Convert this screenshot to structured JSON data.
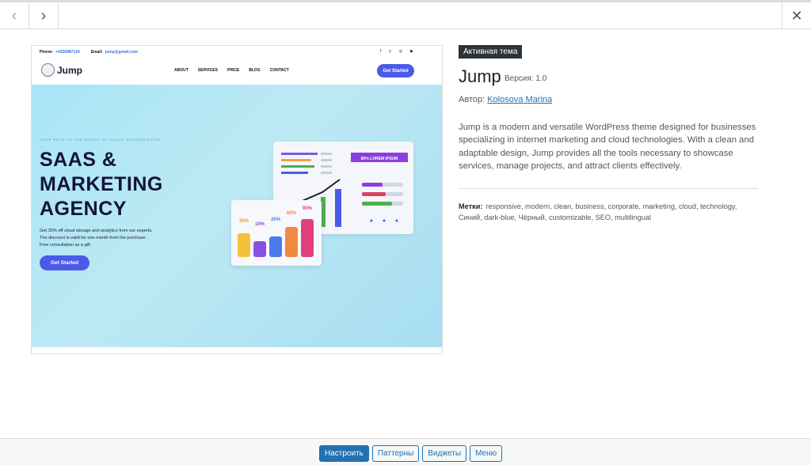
{
  "nav": {
    "prev_icon": "‹",
    "next_icon": "›",
    "close_icon": "✕"
  },
  "preview": {
    "phone_label": "Phone:",
    "phone_value": "+4256987124",
    "email_label": "Email:",
    "email_value": "jump@gmail.com",
    "social": [
      "f",
      "y",
      "◎",
      "▶"
    ],
    "logo_text": "Jump",
    "menu": [
      "ABOUT",
      "SERVICES",
      "PRICE",
      "BLOG",
      "CONTACT"
    ],
    "cta": "Get Started",
    "kicker": "YOUR PATH TO THE WORLD OF CLOUD TECHNOLOGIES",
    "title_line1": "SAAS &",
    "title_line2": "MARKETING",
    "title_line3": "AGENCY",
    "desc_line1": "Get 30% off cloud storage and analytics from our experts.",
    "desc_line2": "The discount is valid for one month from the purchase.",
    "desc_line3": "Free consultation as a gift",
    "hero_button": "Get Started",
    "card_banner": "85% LOREM IPSUM",
    "percents": [
      "30%",
      "10%",
      "20%",
      "60%",
      "90%"
    ]
  },
  "theme": {
    "badge": "Активная тема",
    "name": "Jump",
    "version": "Версия: 1.0",
    "author_label": "Автор:",
    "author_name": "Kolosova Marina",
    "description": "Jump is a modern and versatile WordPress theme designed for businesses specializing in internet marketing and cloud technologies. With a clean and adaptable design, Jump provides all the tools necessary to showcase services, manage projects, and attract clients effectively.",
    "tags_label": "Метки:",
    "tags": "responsive, modern, clean, business, corporate, marketing, cloud, technology, Синий, dark-blue, Чёрный, customizable, SEO, multilingual"
  },
  "footer": {
    "customize": "Настроить",
    "patterns": "Паттерны",
    "widgets": "Виджеты",
    "menu": "Меню"
  },
  "colors": {
    "accent": "#2271b1",
    "hero_blue": "#4b5be8",
    "hero_bg": "#a8e6f7"
  }
}
